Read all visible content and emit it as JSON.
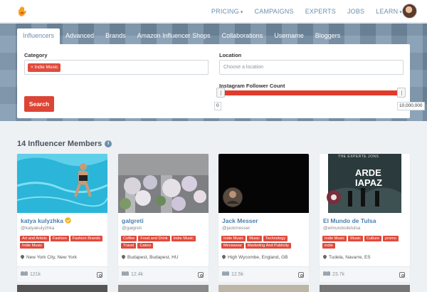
{
  "nav": {
    "logo": "hand-icon",
    "links": [
      {
        "label": "PRICING",
        "caret": "▾"
      },
      {
        "label": "CAMPAIGNS"
      },
      {
        "label": "EXPERTS"
      },
      {
        "label": "JOBS"
      },
      {
        "label": "LEARN",
        "caret": "▾"
      }
    ]
  },
  "tabs": [
    "Influencers",
    "Advanced",
    "Brands",
    "Amazon Influencer Shops",
    "Collaborations",
    "Username",
    "Bloggers"
  ],
  "active_tab": "Influencers",
  "filters": {
    "category_label": "Category",
    "category_chip": "× Indie Music",
    "location_label": "Location",
    "location_placeholder": "Choose a location",
    "follower_label": "Instagram Follower Count",
    "min": "0",
    "max": "10,000,000",
    "search_label": "Search"
  },
  "section": {
    "title": "14 Influencer Members",
    "info": "i"
  },
  "cards": [
    {
      "name": "katya kulyzhka",
      "handle": "@katyakulyzhka",
      "tags": [
        "Art and Artists",
        "Fashion",
        "Fashion Brands",
        "Indie Music"
      ],
      "location": "New York City, New York",
      "followers": "121k"
    },
    {
      "name": "galgreti",
      "handle": "@galgreti",
      "tags": [
        "Coffee",
        "Food and Drink",
        "Indie Music",
        "Travel",
        "Cakes"
      ],
      "location": "Budapest, Budapest, HU",
      "followers": "12.4k"
    },
    {
      "name": "Jack Messer",
      "handle": "@jackmesser",
      "tags": [
        "Indie Music",
        "Music",
        "Technology",
        "Menswear",
        "Marketing And Publicity"
      ],
      "location": "High Wycombe, England, GB",
      "followers": "12.5k"
    },
    {
      "name": "El Mundo de Tulsa",
      "handle": "@elmundodetulsa",
      "tags": [
        "Indie Music",
        "Music",
        "Culture",
        "promo",
        "indie"
      ],
      "location": "Tudela, Navarre, ES",
      "followers": "23.7k"
    }
  ],
  "album": {
    "band": "THE EXPERTE JONS",
    "title_line1": "ARDE",
    "title_line2": "IAPAZ"
  },
  "colors": {
    "accent": "#6a8fb0",
    "tag": "#df4a3c",
    "search": "#dc4536"
  }
}
